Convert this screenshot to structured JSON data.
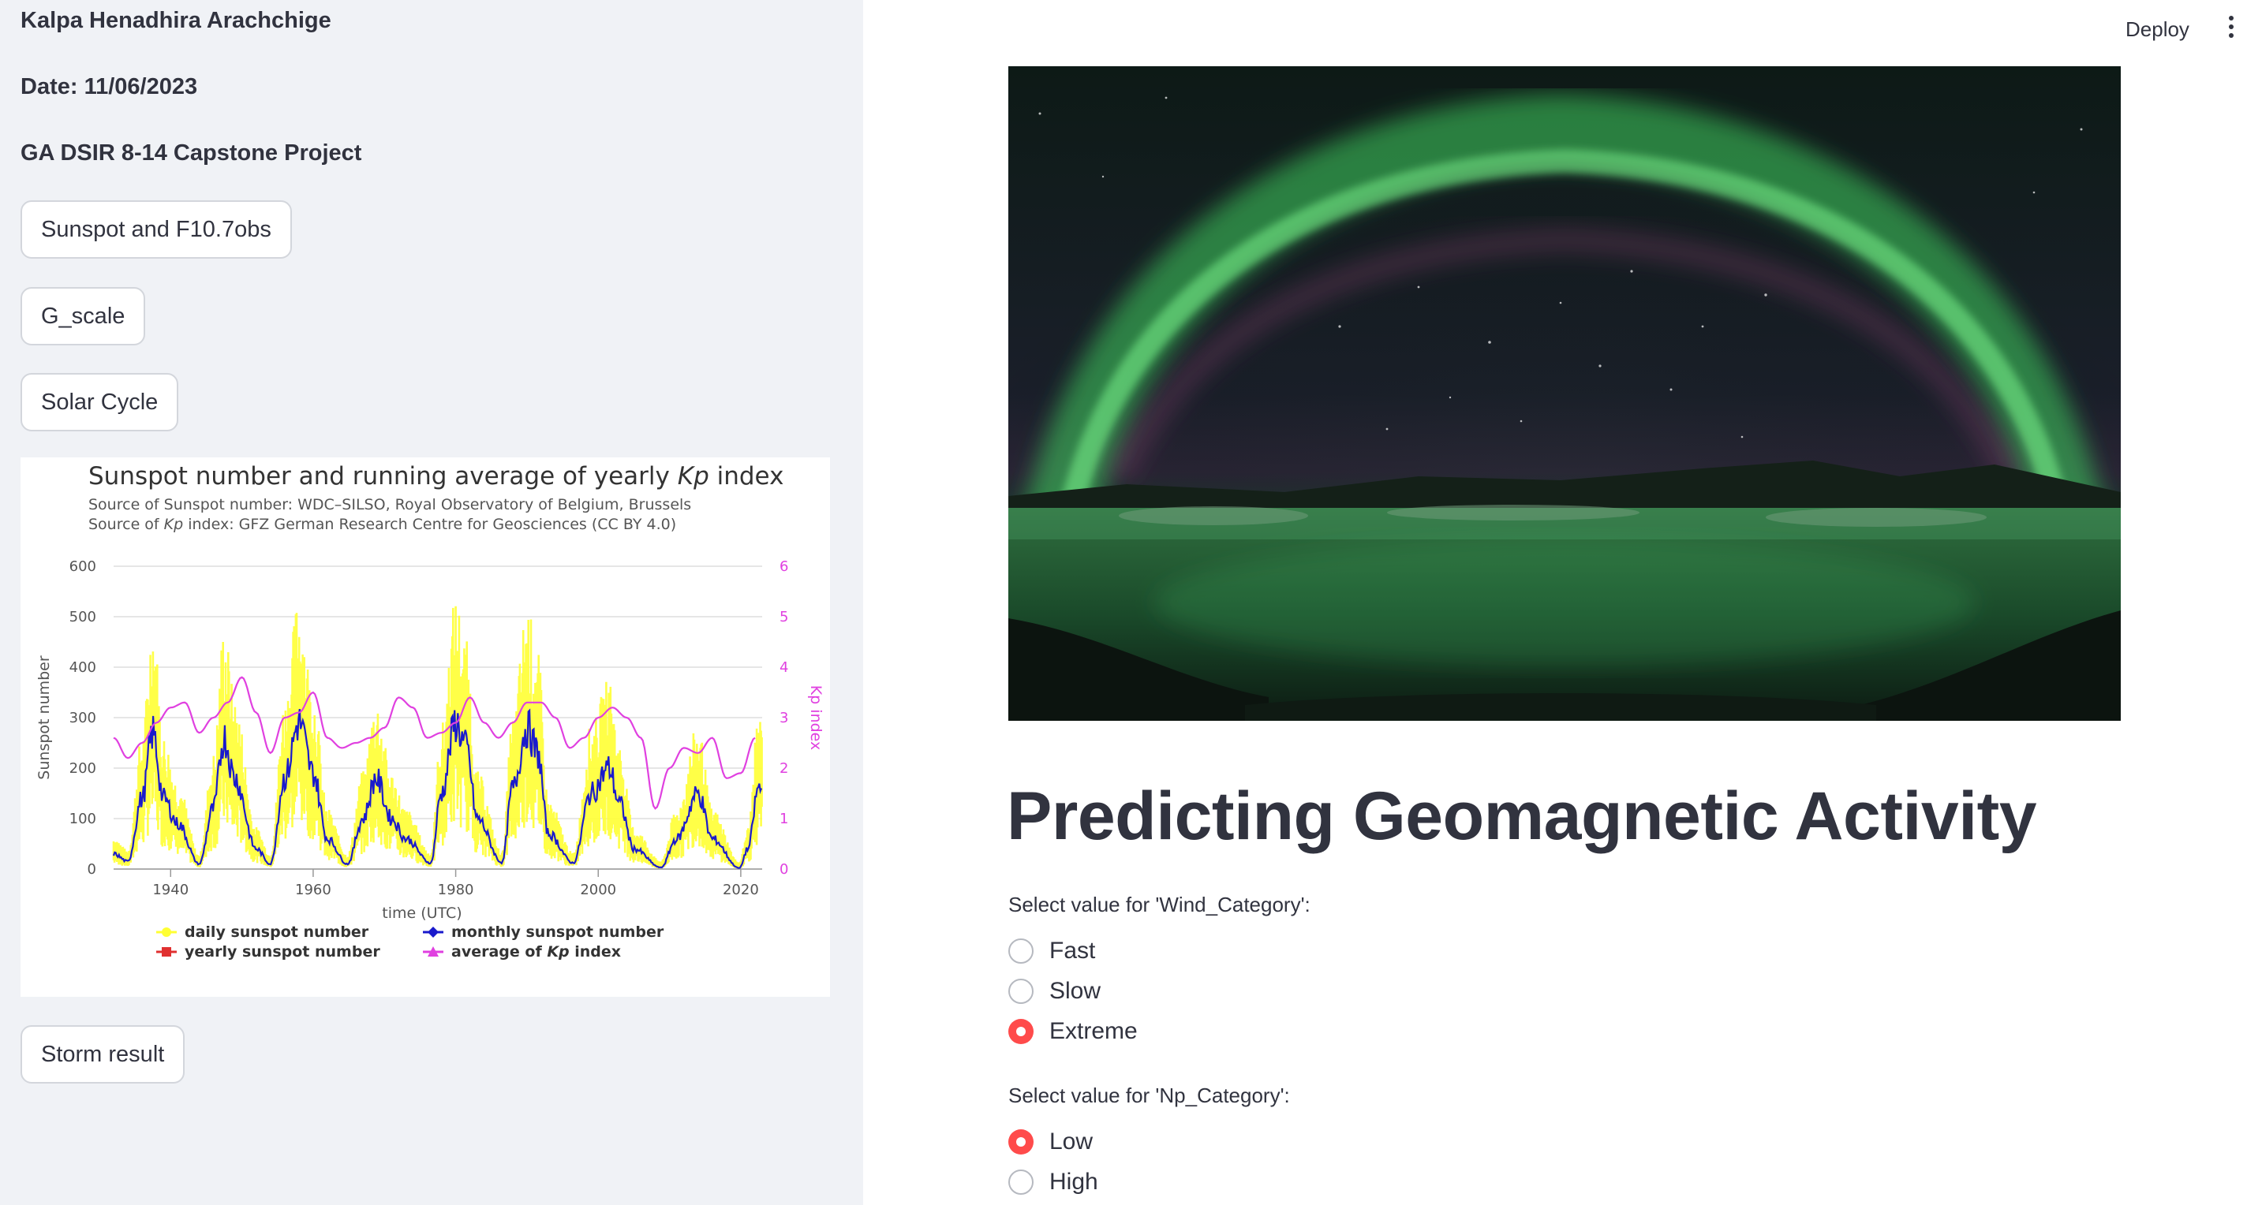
{
  "sidebar": {
    "author": "Kalpa Henadhira Arachchige",
    "date": "Date: 11/06/2023",
    "project": "GA DSIR 8-14 Capstone Project",
    "buttons": [
      "Sunspot and F10.7obs",
      "G_scale",
      "Solar Cycle",
      "Storm result"
    ]
  },
  "toolbar": {
    "deploy_label": "Deploy",
    "menu_icon": "vertical-ellipsis-icon"
  },
  "main": {
    "hero_image": "aurora-over-lagoon-image",
    "title": "Predicting Geomagnetic Activity",
    "questions": [
      {
        "label": "Select value for 'Wind_Category':",
        "options": [
          "Fast",
          "Slow",
          "Extreme"
        ],
        "selected": "Extreme"
      },
      {
        "label": "Select value for 'Np_Category':",
        "options": [
          "Low",
          "High"
        ],
        "selected": "Low"
      }
    ]
  },
  "colors": {
    "accent": "#ff4b4b",
    "sidebar_bg": "#f0f2f6",
    "text": "#31333f",
    "daily": "#ffff33",
    "monthly": "#1a1acc",
    "yearly": "#e03030",
    "kp": "#e040e0"
  },
  "chart_data": {
    "type": "line",
    "title": "Sunspot number and running average of yearly Kp index",
    "title_parts": [
      "Sunspot number and running average of yearly ",
      "Kp",
      " index"
    ],
    "subtitle_1": "Source of Sunspot number: WDC–SILSO, Royal Observatory of Belgium, Brussels",
    "subtitle_2_parts": [
      "Source of ",
      "Kp",
      " index: GFZ German Research Centre for Geosciences (CC BY 4.0)"
    ],
    "xlabel": "time (UTC)",
    "ylabel": "Sunspot number",
    "y2label": "Kp index",
    "xlim": [
      1932,
      2023
    ],
    "ylim": [
      0,
      600
    ],
    "y2lim": [
      0,
      6
    ],
    "xticks": [
      "1940",
      "1960",
      "1980",
      "2000",
      "2020"
    ],
    "yticks": [
      "0",
      "100",
      "200",
      "300",
      "400",
      "500",
      "600"
    ],
    "y2ticks": [
      "0",
      "1",
      "2",
      "3",
      "4",
      "5",
      "6"
    ],
    "grid": true,
    "legend_position": "bottom",
    "legend": [
      "daily sunspot number",
      "monthly sunspot number",
      "yearly sunspot number",
      "average of Kp index"
    ],
    "legend_parts": [
      [
        "daily sunspot number"
      ],
      [
        "monthly sunspot number"
      ],
      [
        "yearly sunspot number"
      ],
      [
        "average of ",
        "Kp",
        " index"
      ]
    ],
    "series": [
      {
        "name": "monthly sunspot number",
        "x": [
          1932,
          1934,
          1936,
          1937.5,
          1939,
          1941,
          1944,
          1946,
          1947.5,
          1949,
          1952,
          1954,
          1956,
          1958,
          1960,
          1962,
          1964.8,
          1967,
          1968.8,
          1971,
          1973,
          1976.5,
          1978,
          1980,
          1981.5,
          1983,
          1986.5,
          1988,
          1990,
          1991.5,
          1993,
          1996.5,
          1999,
          2001.5,
          2003,
          2005,
          2008.8,
          2011,
          2014,
          2016,
          2019.8,
          2021,
          2022.5
        ],
        "y": [
          30,
          15,
          140,
          270,
          140,
          90,
          10,
          120,
          260,
          180,
          40,
          10,
          180,
          290,
          190,
          60,
          10,
          100,
          180,
          100,
          60,
          12,
          150,
          290,
          240,
          100,
          13,
          160,
          280,
          230,
          70,
          12,
          150,
          200,
          130,
          40,
          3,
          60,
          150,
          60,
          2,
          40,
          160
        ]
      },
      {
        "name": "average of Kp index",
        "x": [
          1932,
          1934,
          1936,
          1938,
          1940,
          1942,
          1944,
          1946,
          1948,
          1950,
          1952,
          1954,
          1956,
          1958,
          1960,
          1962,
          1964,
          1966,
          1968,
          1970,
          1972,
          1974,
          1976,
          1978,
          1980,
          1982,
          1984,
          1986,
          1988,
          1990,
          1992,
          1994,
          1996,
          1998,
          2000,
          2002,
          2004,
          2006,
          2008,
          2010,
          2012,
          2014,
          2016,
          2018,
          2020,
          2022
        ],
        "y": [
          2.6,
          2.2,
          2.5,
          2.9,
          3.2,
          3.3,
          2.7,
          3.0,
          3.3,
          3.8,
          3.1,
          2.3,
          3.0,
          3.1,
          3.5,
          2.6,
          2.4,
          2.5,
          2.6,
          2.8,
          3.4,
          3.2,
          2.6,
          2.7,
          2.9,
          3.4,
          2.9,
          2.6,
          2.9,
          3.3,
          3.3,
          3.0,
          2.4,
          2.6,
          3.0,
          3.2,
          3.0,
          2.6,
          1.2,
          2.0,
          2.4,
          2.3,
          2.6,
          1.8,
          1.9,
          2.6
        ]
      }
    ]
  }
}
